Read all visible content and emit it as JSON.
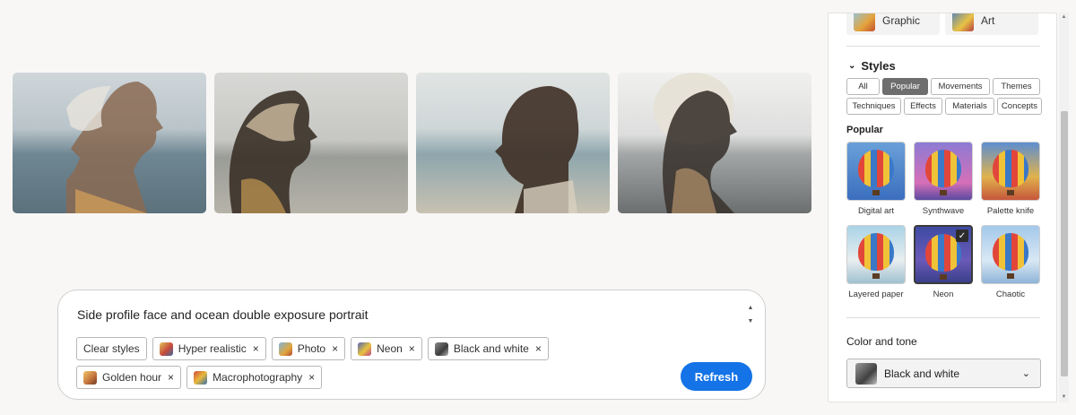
{
  "prompt": {
    "text": "Side profile face and ocean double exposure portrait",
    "chips": [
      {
        "label": "Clear styles",
        "icon": null
      },
      {
        "label": "Hyper realistic",
        "icon": "hr"
      },
      {
        "label": "Photo",
        "icon": "ph"
      },
      {
        "label": "Neon",
        "icon": "ne"
      },
      {
        "label": "Black and white",
        "icon": "bw"
      },
      {
        "label": "Golden hour",
        "icon": "gh"
      },
      {
        "label": "Macrophotography",
        "icon": "mp"
      }
    ],
    "remove_glyph": "×",
    "refresh_label": "Refresh"
  },
  "panel": {
    "content_types": [
      {
        "label": "Graphic"
      },
      {
        "label": "Art"
      }
    ],
    "styles_title": "Styles",
    "filters_row1": [
      "All",
      "Popular",
      "Movements",
      "Themes"
    ],
    "filters_row2": [
      "Techniques",
      "Effects",
      "Materials",
      "Concepts"
    ],
    "active_filter": "Popular",
    "popular_label": "Popular",
    "style_items": [
      {
        "label": "Digital art",
        "selected": false
      },
      {
        "label": "Synthwave",
        "selected": false
      },
      {
        "label": "Palette knife",
        "selected": false
      },
      {
        "label": "Layered paper",
        "selected": false
      },
      {
        "label": "Neon",
        "selected": true
      },
      {
        "label": "Chaotic",
        "selected": false
      }
    ],
    "color_tone_label": "Color and tone",
    "color_tone_value": "Black and white"
  },
  "colors": {
    "accent": "#1473e6",
    "active_filter_bg": "#6e6e6e"
  }
}
